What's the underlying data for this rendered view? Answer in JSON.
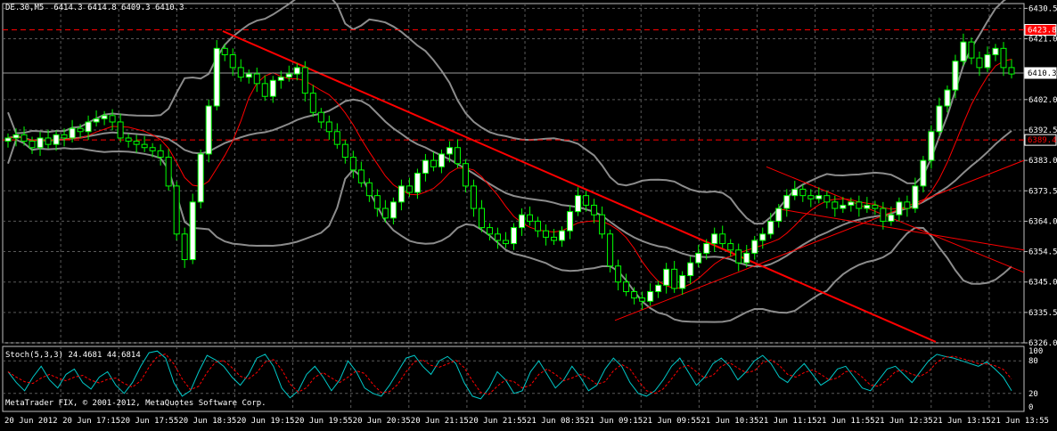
{
  "header": {
    "symbol": "DE.30,M5",
    "ohlc": "6414.3 6414.8 6409.3 6410.3"
  },
  "stoch": {
    "label": "Stoch(5,3,3)",
    "main_value": "24.4681",
    "signal_value": "44.6814"
  },
  "copyright": "MetaTrader FIX, © 2001-2012, MetaQuotes Software Corp.",
  "price_scale": [
    "6430.5",
    "6421.0",
    "6410.3",
    "6402.0",
    "6392.5",
    "6383.0",
    "6373.5",
    "6364.0",
    "6354.5",
    "6345.0",
    "6335.5",
    "6326.0"
  ],
  "stoch_scale": [
    "100",
    "80",
    "20",
    "0"
  ],
  "price_labels": {
    "level_upper": "6423.8",
    "current": "6410.3",
    "level_lower": "6389.4"
  },
  "time_labels": [
    "20 Jun 2012",
    "20 Jun 17:15",
    "20 Jun 17:55",
    "20 Jun 18:35",
    "20 Jun 19:15",
    "20 Jun 19:55",
    "20 Jun 20:35",
    "20 Jun 21:15",
    "20 Jun 21:55",
    "21 Jun 08:35",
    "21 Jun 09:15",
    "21 Jun 09:55",
    "21 Jun 10:35",
    "21 Jun 11:15",
    "21 Jun 11:55",
    "21 Jun 12:35",
    "21 Jun 13:15",
    "21 Jun 13:55"
  ],
  "colors": {
    "background": "#000000",
    "grid": "#5a5a5a",
    "candle_outline": "#00ff00",
    "bull_body": "#ffffff",
    "bear_body": "#000000",
    "trendline": "#ff0000",
    "bollinger": "#8c8c8c",
    "ma": "#ff0000",
    "stoch_main": "#00c8c8",
    "stoch_signal": "#ff0000"
  },
  "chart_data": {
    "type": "candlestick",
    "y_range": [
      6326.0,
      6432.0
    ],
    "closes": [
      6390,
      6391,
      6389,
      6387,
      6390,
      6388,
      6391,
      6390,
      6393,
      6392,
      6395,
      6396,
      6397,
      6395,
      6390,
      6389,
      6388,
      6387,
      6386,
      6384,
      6375,
      6360,
      6352,
      6370,
      6385,
      6400,
      6418,
      6416,
      6412,
      6409,
      6410,
      6407,
      6403,
      6408,
      6409,
      6410,
      6412,
      6404,
      6398,
      6395,
      6392,
      6388,
      6384,
      6380,
      6376,
      6372,
      6368,
      6365,
      6370,
      6375,
      6373,
      6379,
      6383,
      6381,
      6385,
      6387,
      6382,
      6375,
      6368,
      6362,
      6360,
      6358,
      6357,
      6362,
      6366,
      6364,
      6361,
      6359,
      6358,
      6361,
      6367,
      6372,
      6369,
      6366,
      6360,
      6350,
      6345,
      6342,
      6340,
      6339,
      6342,
      6344,
      6349,
      6343,
      6347,
      6351,
      6354,
      6357,
      6360,
      6357,
      6355,
      6351,
      6354,
      6358,
      6360,
      6364,
      6368,
      6372,
      6374,
      6372,
      6371,
      6372,
      6370,
      6368,
      6369,
      6370,
      6368,
      6369,
      6368,
      6364,
      6366,
      6370,
      6368,
      6375,
      6383,
      6392,
      6400,
      6405,
      6414,
      6420,
      6415,
      6412,
      6416,
      6418,
      6412,
      6410
    ],
    "overlays": [
      "Bollinger Bands",
      "Moving Average",
      "Trendlines"
    ],
    "stoch_main": [
      60,
      40,
      25,
      50,
      70,
      45,
      30,
      55,
      65,
      40,
      28,
      50,
      60,
      35,
      20,
      40,
      70,
      95,
      98,
      85,
      40,
      15,
      25,
      60,
      90,
      82,
      70,
      50,
      35,
      55,
      85,
      92,
      70,
      30,
      12,
      25,
      55,
      70,
      50,
      25,
      45,
      80,
      60,
      30,
      20,
      15,
      35,
      60,
      85,
      90,
      70,
      55,
      80,
      88,
      75,
      40,
      15,
      10,
      30,
      60,
      45,
      20,
      25,
      60,
      80,
      55,
      30,
      45,
      70,
      50,
      25,
      35,
      65,
      85,
      70,
      40,
      20,
      15,
      25,
      45,
      70,
      85,
      60,
      35,
      50,
      75,
      85,
      70,
      45,
      60,
      80,
      90,
      75,
      50,
      40,
      60,
      75,
      55,
      35,
      45,
      65,
      70,
      50,
      30,
      25,
      45,
      65,
      70,
      55,
      40,
      60,
      80,
      92,
      88,
      85,
      80,
      75,
      70,
      78,
      65,
      50,
      25
    ]
  }
}
